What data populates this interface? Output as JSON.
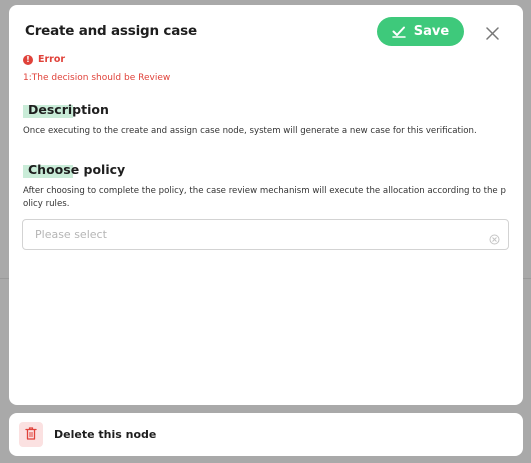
{
  "header": {
    "title": "Create and assign case",
    "save_label": "Save"
  },
  "error": {
    "label": "Error",
    "message": "1:The decision should be Review"
  },
  "description": {
    "heading": "Description",
    "text": "Once executing to the create and assign case node, system will generate a new case for this verification."
  },
  "policy": {
    "heading": "Choose policy",
    "text": "After choosing to complete the policy, the case review mechanism will execute the allocation according to the policy rules.",
    "select_placeholder": "Please select"
  },
  "footer": {
    "delete_label": "Delete this node"
  },
  "colors": {
    "accent": "#3ec97b",
    "error": "#e0423a",
    "highlight": "#c9ecd8",
    "danger_bg": "#fbe1e1"
  }
}
